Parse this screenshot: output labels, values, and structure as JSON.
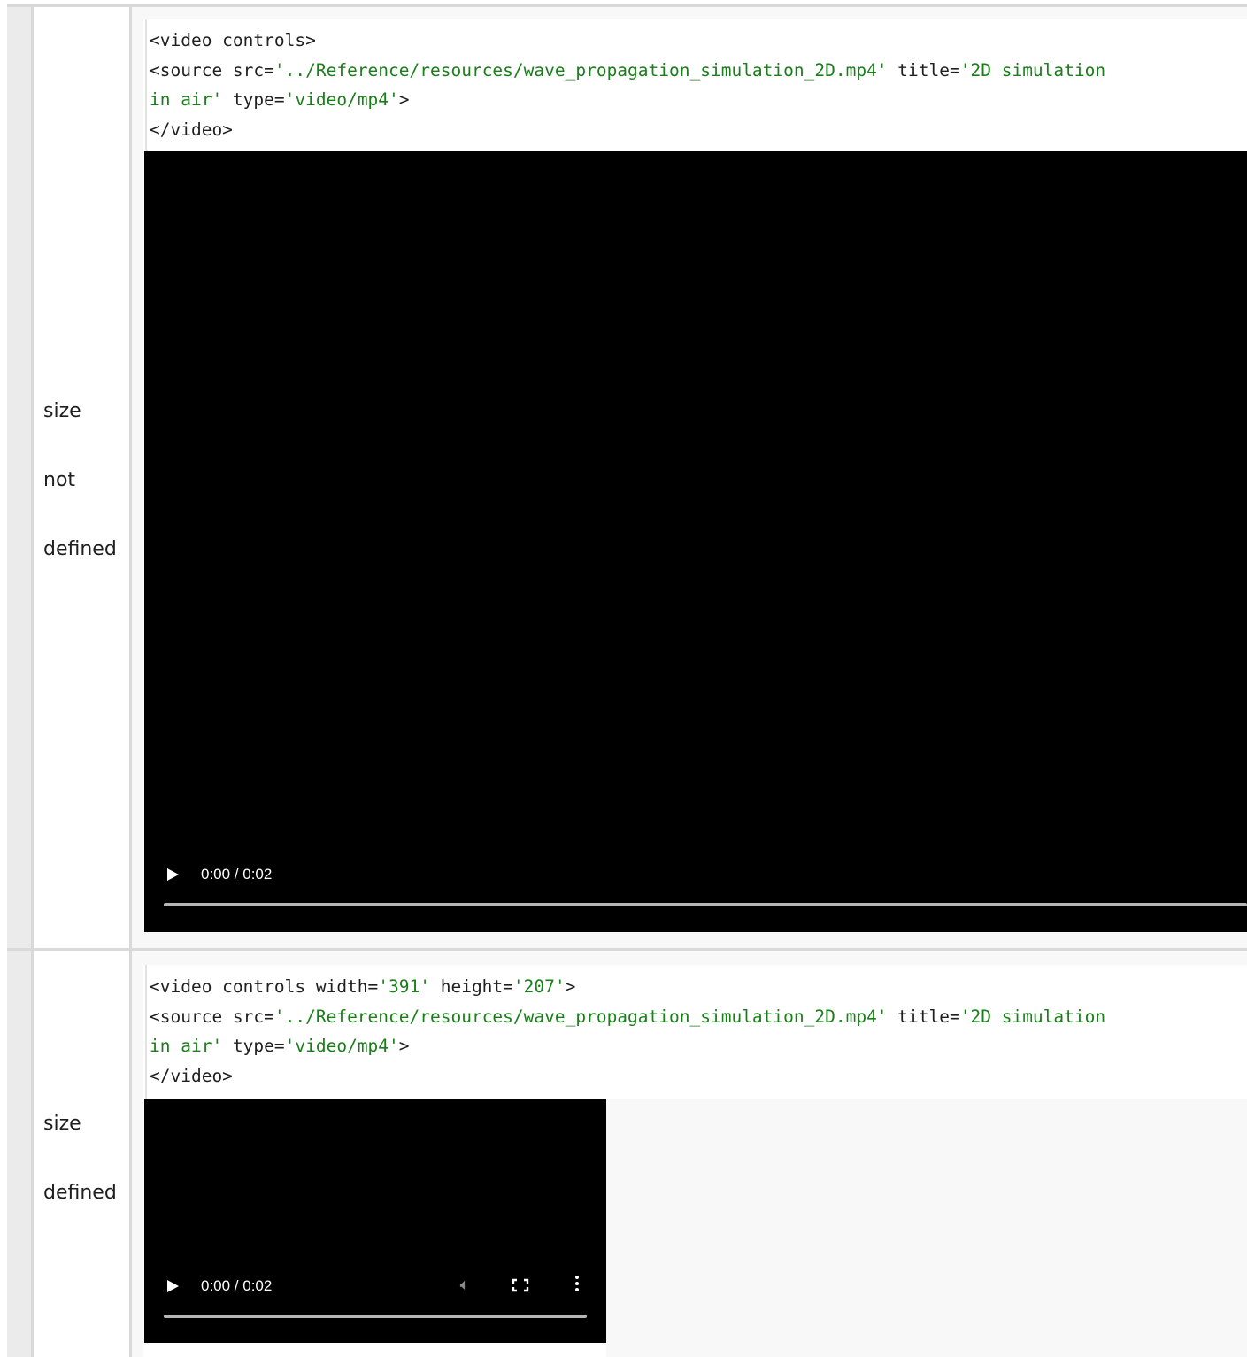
{
  "rows": [
    {
      "label_words": [
        "size",
        "not",
        "defined"
      ],
      "code_lines": [
        [
          {
            "t": "<video controls>",
            "k": "plain"
          }
        ],
        [
          {
            "t": "<source src=",
            "k": "plain"
          },
          {
            "t": "'../Reference/resources/wave_propagation_simulation_2D.mp4'",
            "k": "str"
          },
          {
            "t": " title=",
            "k": "plain"
          },
          {
            "t": "'2D simulation",
            "k": "str"
          }
        ],
        [
          {
            "t": "in air'",
            "k": "str"
          },
          {
            "t": " type=",
            "k": "plain"
          },
          {
            "t": "'video/mp4'",
            "k": "str"
          },
          {
            "t": ">",
            "k": "plain"
          }
        ],
        [
          {
            "t": "</video>",
            "k": "plain"
          }
        ]
      ],
      "video": {
        "time": "0:00 / 0:02",
        "play_icon": "play-icon",
        "progress_fraction": 0.0
      }
    },
    {
      "label_words": [
        "size",
        "defined"
      ],
      "code_lines": [
        [
          {
            "t": "<video controls width=",
            "k": "plain"
          },
          {
            "t": "'391'",
            "k": "str"
          },
          {
            "t": " height=",
            "k": "plain"
          },
          {
            "t": "'207'",
            "k": "str"
          },
          {
            "t": ">",
            "k": "plain"
          }
        ],
        [
          {
            "t": "<source src=",
            "k": "plain"
          },
          {
            "t": "'../Reference/resources/wave_propagation_simulation_2D.mp4'",
            "k": "str"
          },
          {
            "t": " title=",
            "k": "plain"
          },
          {
            "t": "'2D simulation",
            "k": "str"
          }
        ],
        [
          {
            "t": "in air'",
            "k": "str"
          },
          {
            "t": " type=",
            "k": "plain"
          },
          {
            "t": "'video/mp4'",
            "k": "str"
          },
          {
            "t": ">",
            "k": "plain"
          }
        ],
        [
          {
            "t": "</video>",
            "k": "plain"
          }
        ]
      ],
      "video": {
        "time": "0:00 / 0:02",
        "play_icon": "play-icon",
        "mute_icon": "volume-icon",
        "fullscreen_icon": "fullscreen-icon",
        "more_icon": "more-options-icon",
        "progress_fraction": 0.0
      }
    }
  ],
  "colors": {
    "string": "#1a7f1a",
    "text": "#1f1f1f",
    "gutter": "#ebebeb",
    "cell_background": "#f8f8f8",
    "video_background": "#000000"
  }
}
